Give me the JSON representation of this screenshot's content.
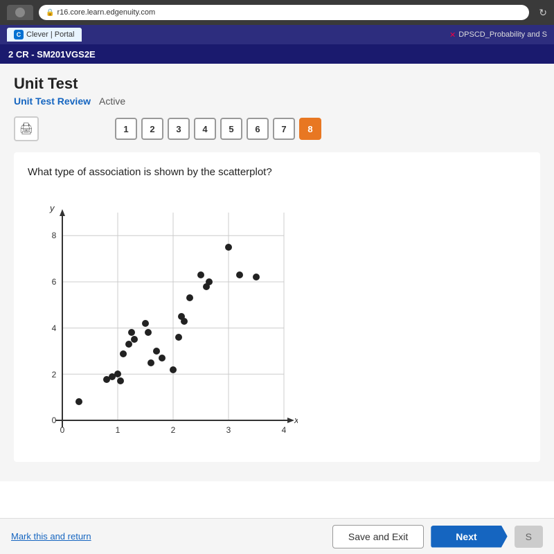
{
  "browser": {
    "url": "r16.core.learn.edgenuity.com",
    "clever_tab": "Clever | Portal",
    "dpscd_tab": "DPSCD_Probability and S",
    "course": "2 CR - SM201VGS2E"
  },
  "page": {
    "title": "Unit Test",
    "breadcrumb_link": "Unit Test Review",
    "breadcrumb_status": "Active"
  },
  "toolbar": {
    "print_icon": "🖨",
    "question_numbers": [
      "1",
      "2",
      "3",
      "4",
      "5",
      "6",
      "7",
      "8"
    ],
    "active_question": 8
  },
  "question": {
    "text": "What type of association is shown by the scatterplot?",
    "chart": {
      "x_label": "x",
      "y_label": "y",
      "x_max": 4,
      "y_max": 9,
      "points": [
        [
          0.3,
          0.8
        ],
        [
          0.8,
          1.6
        ],
        [
          0.9,
          1.9
        ],
        [
          1.0,
          2.1
        ],
        [
          1.05,
          1.7
        ],
        [
          1.1,
          2.9
        ],
        [
          1.2,
          3.3
        ],
        [
          1.25,
          3.8
        ],
        [
          1.3,
          3.5
        ],
        [
          1.5,
          4.2
        ],
        [
          1.55,
          3.8
        ],
        [
          1.6,
          2.5
        ],
        [
          1.7,
          3.0
        ],
        [
          1.8,
          2.7
        ],
        [
          2.0,
          2.2
        ],
        [
          2.1,
          3.6
        ],
        [
          2.15,
          4.5
        ],
        [
          2.2,
          4.3
        ],
        [
          2.3,
          5.3
        ],
        [
          2.5,
          6.3
        ],
        [
          2.6,
          5.8
        ],
        [
          2.65,
          6.0
        ],
        [
          3.0,
          7.5
        ],
        [
          3.2,
          6.3
        ],
        [
          3.5,
          6.2
        ]
      ]
    }
  },
  "footer": {
    "mark_return": "Mark this and return",
    "save_exit": "Save and Exit",
    "next": "Next",
    "submit": "S"
  }
}
